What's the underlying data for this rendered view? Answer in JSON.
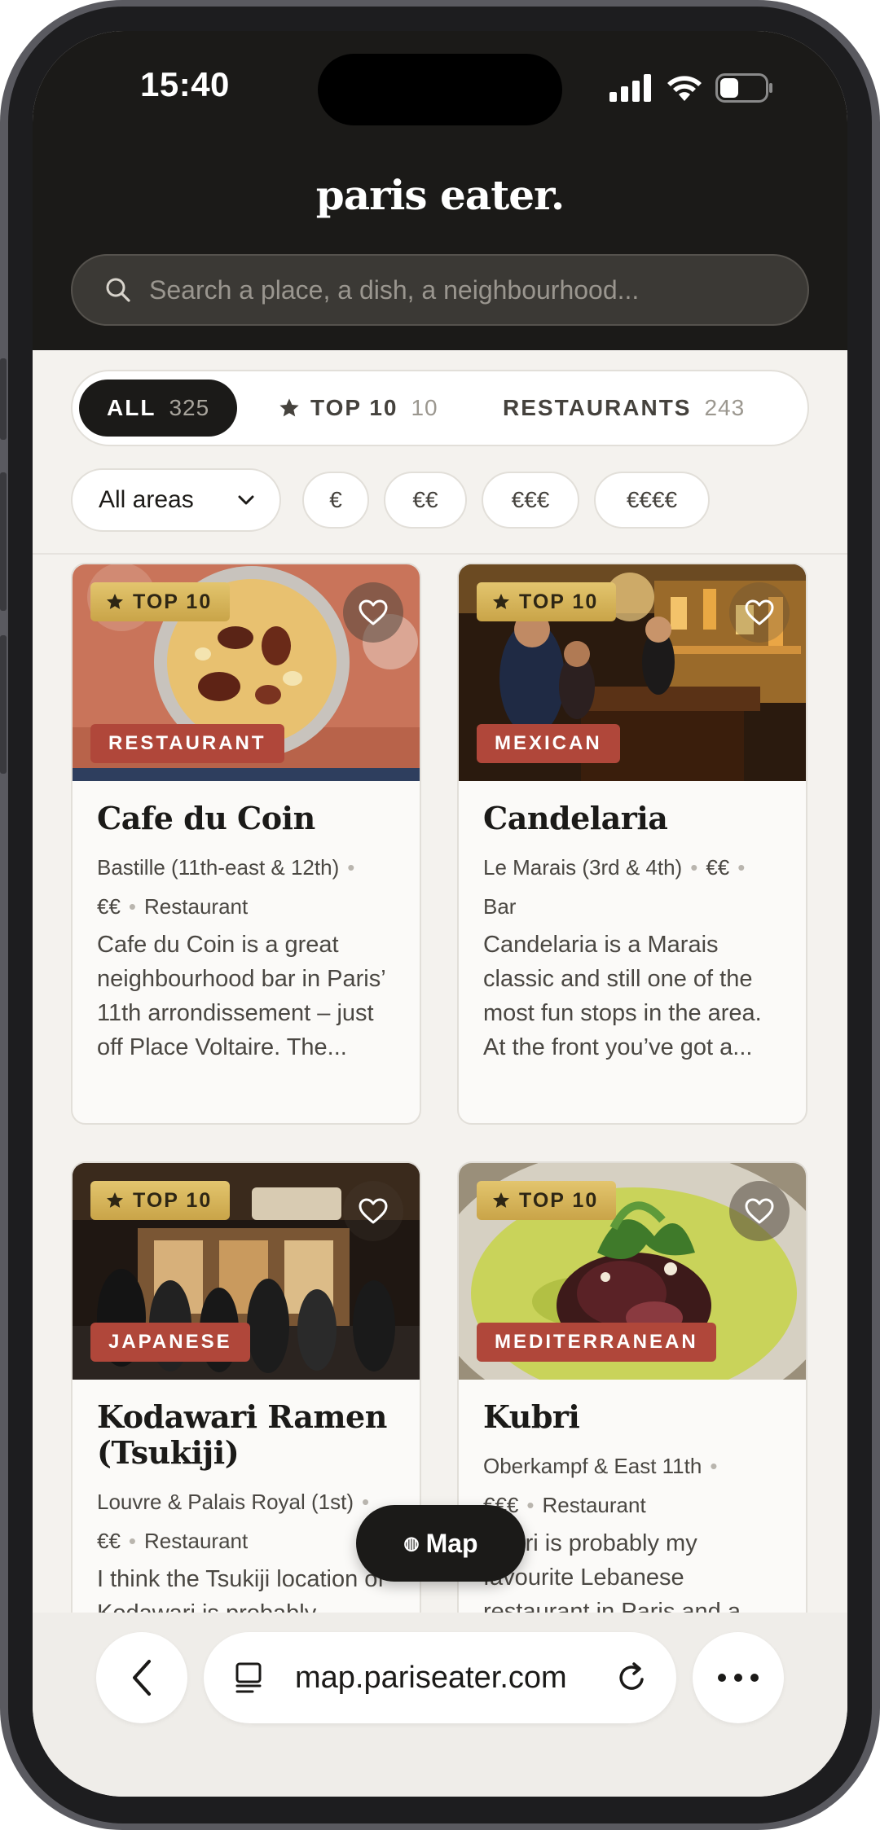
{
  "status": {
    "time": "15:40"
  },
  "brand": "paris eater.",
  "search": {
    "placeholder": "Search a place, a dish, a neighbourhood..."
  },
  "tabs": [
    {
      "label": "ALL",
      "count": "325"
    },
    {
      "label": "TOP 10",
      "count": "10"
    },
    {
      "label": "RESTAURANTS",
      "count": "243"
    }
  ],
  "filters": {
    "area": "All areas",
    "prices": [
      "€",
      "€€",
      "€€€",
      "€€€€"
    ]
  },
  "cards": [
    {
      "badge": "TOP 10",
      "category": "RESTAURANT",
      "title": "Cafe du Coin",
      "meta1": "Bastille (11th-east & 12th)",
      "price": "€€",
      "type": "Restaurant",
      "desc": "Cafe du Coin is a great neighbourhood bar in Paris’ 11th arrondissement – just off Place Voltaire. The..."
    },
    {
      "badge": "TOP 10",
      "category": "MEXICAN",
      "title": "Candelaria",
      "meta1": "Le Marais (3rd & 4th)",
      "price": "€€",
      "type": "Bar",
      "desc": "Candelaria is a Marais classic and still one of the most fun stops in the area. At the front you’ve got a..."
    },
    {
      "badge": "TOP 10",
      "category": "JAPANESE",
      "title": "Kodawari Ramen (Tsukiji)",
      "meta1": "Louvre & Palais Royal (1st)",
      "price": "€€",
      "type": "Restaurant",
      "desc": "I think the Tsukiji location of Kodawari is probably"
    },
    {
      "badge": "TOP 10",
      "category": "MEDITERRANEAN",
      "title": "Kubri",
      "meta1": "Oberkampf & East 11th",
      "price": "€€€",
      "type": "Restaurant",
      "desc": "Kubri is probably my favourite Lebanese restaurant in Paris and a"
    }
  ],
  "map_button": {
    "label": "Map"
  },
  "browser": {
    "url": "map.pariseater.com"
  }
}
